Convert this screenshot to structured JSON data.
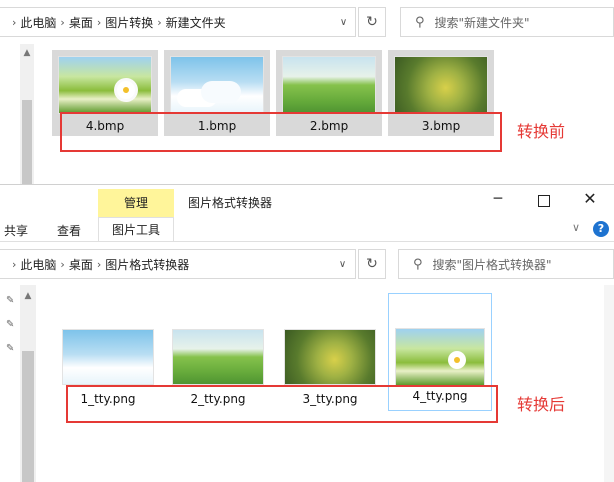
{
  "top_window": {
    "breadcrumb": [
      "此电脑",
      "桌面",
      "图片转换",
      "新建文件夹"
    ],
    "search_placeholder": "搜索\"新建文件夹\"",
    "files": [
      {
        "name": "4.bmp",
        "thumb": "daisy-field"
      },
      {
        "name": "1.bmp",
        "thumb": "clouds-sky"
      },
      {
        "name": "2.bmp",
        "thumb": "green-meadow"
      },
      {
        "name": "3.bmp",
        "thumb": "yellow-flowers"
      }
    ],
    "annotation": "转换前"
  },
  "bottom_window": {
    "ribbon": {
      "context_group": "管理",
      "window_title": "图片格式转换器",
      "tabs": [
        "共享",
        "查看",
        "图片工具"
      ]
    },
    "breadcrumb": [
      "此电脑",
      "桌面",
      "图片格式转换器"
    ],
    "search_placeholder": "搜索\"图片格式转换器\"",
    "files": [
      {
        "name": "1_tty.png",
        "thumb": "clouds-sky"
      },
      {
        "name": "2_tty.png",
        "thumb": "green-meadow"
      },
      {
        "name": "3_tty.png",
        "thumb": "yellow-flowers"
      },
      {
        "name": "4_tty.png",
        "thumb": "daisy-field"
      }
    ],
    "annotation": "转换后"
  },
  "colors": {
    "accent_red": "#e53935",
    "ribbon_yellow": "#fff59a",
    "selection_blue": "#cce8ff"
  }
}
